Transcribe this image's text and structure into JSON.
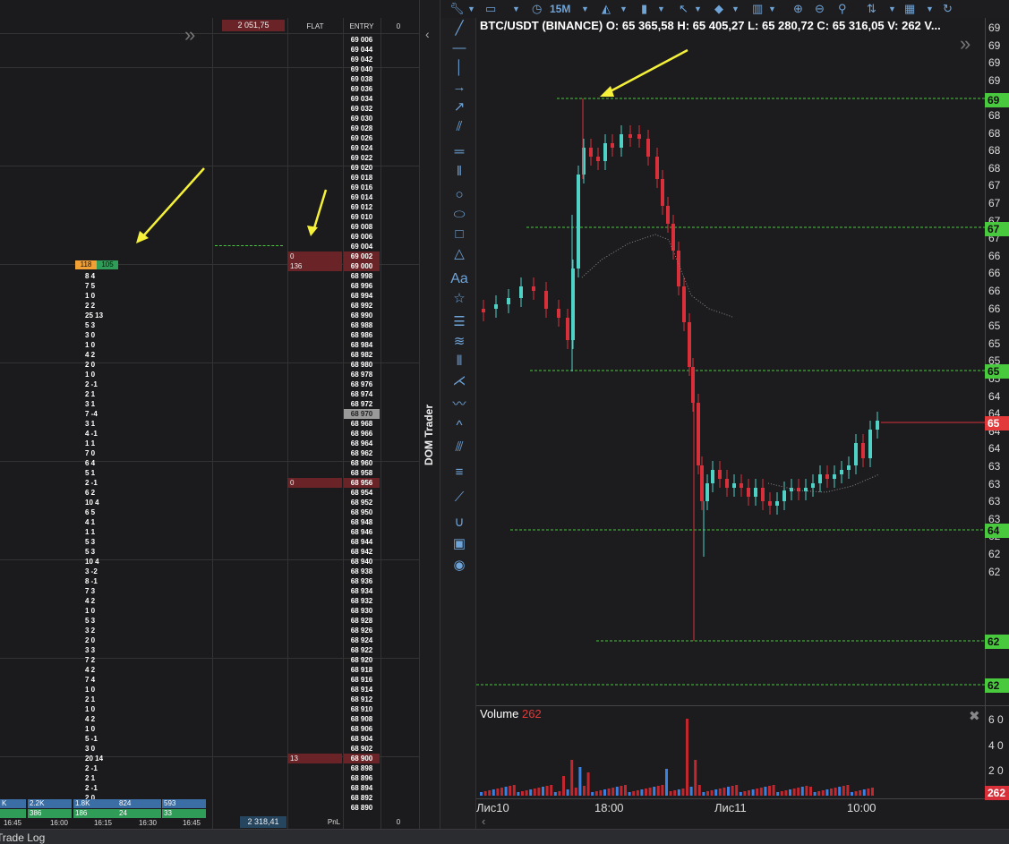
{
  "dom": {
    "top_value": "2 051,75",
    "col_flat": "FLAT",
    "col_entry": "ENTRY",
    "col_zero": "0",
    "bottom_value": "2 318,41",
    "pnl_label": "PnL",
    "pnl_value": "0",
    "prices": [
      "69 006",
      "69 044",
      "69 042",
      "69 040",
      "69 038",
      "69 036",
      "69 034",
      "69 032",
      "69 030",
      "69 028",
      "69 026",
      "69 024",
      "69 022",
      "69 020",
      "69 018",
      "69 016",
      "69 014",
      "69 012",
      "69 010",
      "69 008",
      "69 006",
      "69 004",
      "69 002",
      "69 000",
      "68 998",
      "68 996",
      "68 994",
      "68 992",
      "68 990",
      "68 988",
      "68 986",
      "68 984",
      "68 982",
      "68 980",
      "68 978",
      "68 976",
      "68 974",
      "68 972",
      "68 970",
      "68 968",
      "68 966",
      "68 964",
      "68 962",
      "68 960",
      "68 958",
      "68 956",
      "68 954",
      "68 952",
      "68 950",
      "68 948",
      "68 946",
      "68 944",
      "68 942",
      "68 940",
      "68 938",
      "68 936",
      "68 934",
      "68 932",
      "68 930",
      "68 928",
      "68 926",
      "68 924",
      "68 922",
      "68 920",
      "68 918",
      "68 916",
      "68 914",
      "68 912",
      "68 910",
      "68 908",
      "68 906",
      "68 904",
      "68 902",
      "68 900",
      "68 898",
      "68 896",
      "68 894",
      "68 892",
      "68 890"
    ],
    "orders": [
      {
        "row": 22,
        "text": "0"
      },
      {
        "row": 23,
        "text": "136"
      },
      {
        "row": 45,
        "text": "0"
      },
      {
        "row": 73,
        "text": "13"
      }
    ],
    "highlight_row": 38,
    "volume_pairs": [
      {
        "row": 24,
        "t": "8 4"
      },
      {
        "row": 25,
        "t": "7 5"
      },
      {
        "row": 26,
        "t": "1 0"
      },
      {
        "row": 27,
        "t": "2 2"
      },
      {
        "row": 28,
        "t": "25 13"
      },
      {
        "row": 29,
        "t": "5 3"
      },
      {
        "row": 30,
        "t": "3 0"
      },
      {
        "row": 31,
        "t": "1 0"
      },
      {
        "row": 32,
        "t": "4 2"
      },
      {
        "row": 33,
        "t": "2 0"
      },
      {
        "row": 34,
        "t": "1 0"
      },
      {
        "row": 35,
        "t": "2 -1"
      },
      {
        "row": 36,
        "t": "2 1"
      },
      {
        "row": 37,
        "t": "3 1"
      },
      {
        "row": 38,
        "t": "7 -4"
      },
      {
        "row": 39,
        "t": "3 1"
      },
      {
        "row": 40,
        "t": "4 -1"
      },
      {
        "row": 41,
        "t": "1 1"
      },
      {
        "row": 42,
        "t": "7 0"
      },
      {
        "row": 43,
        "t": "6 4"
      },
      {
        "row": 44,
        "t": "5 1"
      },
      {
        "row": 45,
        "t": "2 -1"
      },
      {
        "row": 46,
        "t": "6 2"
      },
      {
        "row": 47,
        "t": "10 4"
      },
      {
        "row": 48,
        "t": "6 5"
      },
      {
        "row": 49,
        "t": "4 1"
      },
      {
        "row": 50,
        "t": "1 1"
      },
      {
        "row": 51,
        "t": "5 3"
      },
      {
        "row": 52,
        "t": "5 3"
      },
      {
        "row": 53,
        "t": "10 4"
      },
      {
        "row": 54,
        "t": "3 -2"
      },
      {
        "row": 55,
        "t": "8 -1"
      },
      {
        "row": 56,
        "t": "7 3"
      },
      {
        "row": 57,
        "t": "4 2"
      },
      {
        "row": 58,
        "t": "1 0"
      },
      {
        "row": 59,
        "t": "5 3"
      },
      {
        "row": 60,
        "t": "3 2"
      },
      {
        "row": 61,
        "t": "2 0"
      },
      {
        "row": 62,
        "t": "3 3"
      },
      {
        "row": 63,
        "t": "7 2"
      },
      {
        "row": 64,
        "t": "4 2"
      },
      {
        "row": 65,
        "t": "7 4"
      },
      {
        "row": 66,
        "t": "1 0"
      },
      {
        "row": 67,
        "t": "2 1"
      },
      {
        "row": 68,
        "t": "1 0"
      },
      {
        "row": 69,
        "t": "4 2"
      },
      {
        "row": 70,
        "t": "1 0"
      },
      {
        "row": 71,
        "t": "5 -1"
      },
      {
        "row": 72,
        "t": "3 0"
      },
      {
        "row": 73,
        "t": "20 14"
      },
      {
        "row": 74,
        "t": "2 -1"
      },
      {
        "row": 75,
        "t": "2 1"
      },
      {
        "row": 76,
        "t": "2 -1"
      },
      {
        "row": 77,
        "t": "2 0"
      }
    ],
    "best_bid_ask": {
      "a": "118",
      "b": "105"
    },
    "hist_blue": [
      "2.2K",
      "1.8K",
      "824",
      "593"
    ],
    "hist_green": [
      "386",
      "186",
      "24",
      "33"
    ],
    "hist_left_blue": "K",
    "times": [
      "16:45",
      "16:00",
      "16:15",
      "16:30",
      "16:45"
    ]
  },
  "side_tab": "DOM Trader",
  "chart": {
    "symbol_line": "BTC/USDT (BINANCE)  O: 65 365,58   H: 65 405,27   L: 65 280,72   C: 65 316,05   V: 262 V...",
    "toolbar": {
      "interval": "15M"
    },
    "volume_label": "Volume",
    "volume_value": "262",
    "x_labels": [
      "Лис10",
      "18:00",
      "Лис11",
      "10:00"
    ],
    "axis_labels": [
      "69",
      "69",
      "69",
      "69",
      "69",
      "68",
      "68",
      "68",
      "68",
      "67",
      "67",
      "67",
      "67",
      "66",
      "66",
      "66",
      "66",
      "65",
      "65",
      "65",
      "65",
      "64",
      "64",
      "64",
      "64",
      "63",
      "63",
      "63",
      "63",
      "62",
      "62",
      "62"
    ],
    "badges": [
      {
        "text": "69",
        "color": "#49c93e"
      },
      {
        "text": "67",
        "color": "#49c93e"
      },
      {
        "text": "65",
        "color": "#49c93e"
      },
      {
        "text": "65",
        "color": "#e23a3a"
      },
      {
        "text": "64",
        "color": "#49c93e"
      },
      {
        "text": "62",
        "color": "#49c93e"
      },
      {
        "text": "62",
        "color": "#49c93e"
      }
    ],
    "vol_axis": [
      "6 0",
      "4 0",
      "2 0"
    ],
    "vol_badge": "262",
    "bottom_tab": "Trade Log",
    "colors": {
      "up": "#4fd1c5",
      "down": "#d8303a",
      "level": "#49c93e",
      "arrow": "#f5f03a"
    }
  }
}
